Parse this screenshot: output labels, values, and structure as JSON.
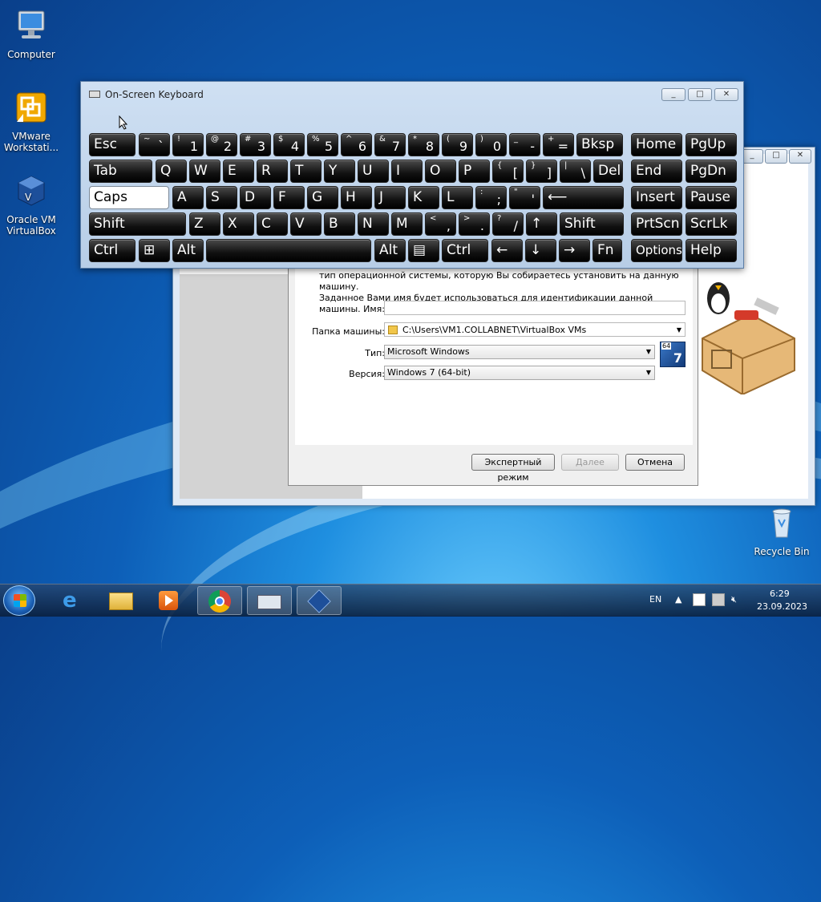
{
  "desktop": {
    "icons": [
      {
        "label": "Computer"
      },
      {
        "label": "VMware Workstati..."
      },
      {
        "label": "Oracle VM VirtualBox"
      },
      {
        "label": "Recycle Bin"
      }
    ]
  },
  "osk": {
    "title": "On-Screen Keyboard",
    "rows": [
      [
        {
          "main": "Esc"
        },
        {
          "sub": "~",
          "base": "`"
        },
        {
          "sub": "!",
          "base": "1"
        },
        {
          "sub": "@",
          "base": "2"
        },
        {
          "sub": "#",
          "base": "3"
        },
        {
          "sub": "$",
          "base": "4"
        },
        {
          "sub": "%",
          "base": "5"
        },
        {
          "sub": "^",
          "base": "6"
        },
        {
          "sub": "&",
          "base": "7"
        },
        {
          "sub": "*",
          "base": "8"
        },
        {
          "sub": "(",
          "base": "9"
        },
        {
          "sub": ")",
          "base": "0"
        },
        {
          "sub": "_",
          "base": "-"
        },
        {
          "sub": "+",
          "base": "="
        },
        {
          "main": "Bksp"
        },
        {
          "main": "Home"
        },
        {
          "main": "PgUp"
        }
      ],
      [
        {
          "main": "Tab"
        },
        {
          "main": "Q"
        },
        {
          "main": "W"
        },
        {
          "main": "E"
        },
        {
          "main": "R"
        },
        {
          "main": "T"
        },
        {
          "main": "Y"
        },
        {
          "main": "U"
        },
        {
          "main": "I"
        },
        {
          "main": "O"
        },
        {
          "main": "P"
        },
        {
          "sub": "{",
          "base": "["
        },
        {
          "sub": "}",
          "base": "]"
        },
        {
          "sub": "|",
          "base": "\\"
        },
        {
          "main": "Del"
        },
        {
          "main": "End"
        },
        {
          "main": "PgDn"
        }
      ],
      [
        {
          "main": "Caps"
        },
        {
          "main": "A"
        },
        {
          "main": "S"
        },
        {
          "main": "D"
        },
        {
          "main": "F"
        },
        {
          "main": "G"
        },
        {
          "main": "H"
        },
        {
          "main": "J"
        },
        {
          "main": "K"
        },
        {
          "main": "L"
        },
        {
          "sub": ":",
          "base": ";"
        },
        {
          "sub": "\"",
          "base": "'"
        },
        {
          "main": "⟵"
        },
        {
          "main": "Insert"
        },
        {
          "main": "Pause"
        }
      ],
      [
        {
          "main": "Shift"
        },
        {
          "main": "Z"
        },
        {
          "main": "X"
        },
        {
          "main": "C"
        },
        {
          "main": "V"
        },
        {
          "main": "B"
        },
        {
          "main": "N"
        },
        {
          "main": "M"
        },
        {
          "sub": "<",
          "base": ","
        },
        {
          "sub": ">",
          "base": "."
        },
        {
          "sub": "?",
          "base": "/"
        },
        {
          "main": "↑"
        },
        {
          "main": "Shift"
        },
        {
          "main": "PrtScn"
        },
        {
          "main": "ScrLk"
        }
      ],
      [
        {
          "main": "Ctrl"
        },
        {
          "main": "⊞"
        },
        {
          "main": "Alt"
        },
        {
          "main": ""
        },
        {
          "main": "Alt"
        },
        {
          "main": "▤"
        },
        {
          "main": "Ctrl"
        },
        {
          "main": "←"
        },
        {
          "main": "↓"
        },
        {
          "main": "→"
        },
        {
          "main": "Fn"
        },
        {
          "main": "Options"
        },
        {
          "main": "Help"
        }
      ]
    ]
  },
  "dialog": {
    "desc_line1": "тип операционной системы, которую Вы собираетесь установить на данную машину.",
    "desc_line2": "Заданное Вами имя будет использоваться для идентификации данной машины.",
    "name_label": "Имя:",
    "name_value": "",
    "folder_label": "Папка машины:",
    "folder_value": "C:\\Users\\VM1.COLLABNET\\VirtualBox VMs",
    "type_label": "Тип:",
    "type_value": "Microsoft Windows",
    "version_label": "Версия:",
    "version_value": "Windows 7 (64-bit)",
    "os_badge": "64",
    "expert_button": "Экспертный режим",
    "next_button": "Далее",
    "cancel_button": "Отмена"
  },
  "taskbar": {
    "lang": "EN",
    "time": "6:29",
    "date": "23.09.2023"
  }
}
